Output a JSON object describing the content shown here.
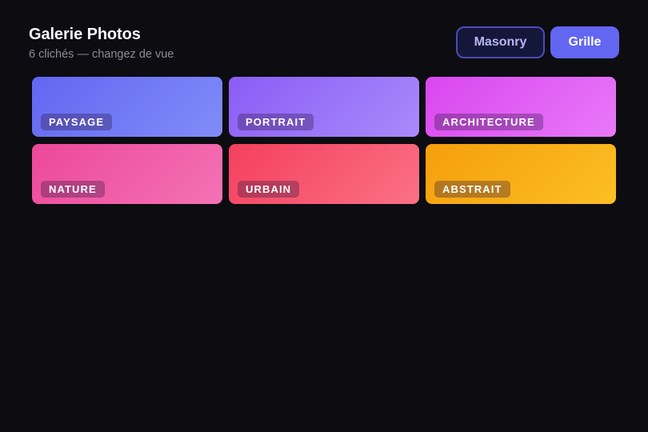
{
  "header": {
    "title": "Galerie Photos",
    "subtitle": "6 clichés — changez de vue"
  },
  "view_toggle": {
    "masonry_label": "Masonry",
    "grid_label": "Grille",
    "selected": "Grille"
  },
  "gallery": {
    "items": [
      {
        "label": "PAYSAGE",
        "color_from": "#6366f1",
        "color_to": "#818cf8"
      },
      {
        "label": "PORTRAIT",
        "color_from": "#8b5cf6",
        "color_to": "#a78bfa"
      },
      {
        "label": "ARCHITECTURE",
        "color_from": "#d946ef",
        "color_to": "#e879f9"
      },
      {
        "label": "NATURE",
        "color_from": "#ec4899",
        "color_to": "#f472b6"
      },
      {
        "label": "URBAIN",
        "color_from": "#f43f5e",
        "color_to": "#fb7185"
      },
      {
        "label": "ABSTRAIT",
        "color_from": "#f59e0b",
        "color_to": "#fbbf24"
      }
    ]
  },
  "colors": {
    "background": "#0c0c11",
    "accent": "#6366f1"
  }
}
